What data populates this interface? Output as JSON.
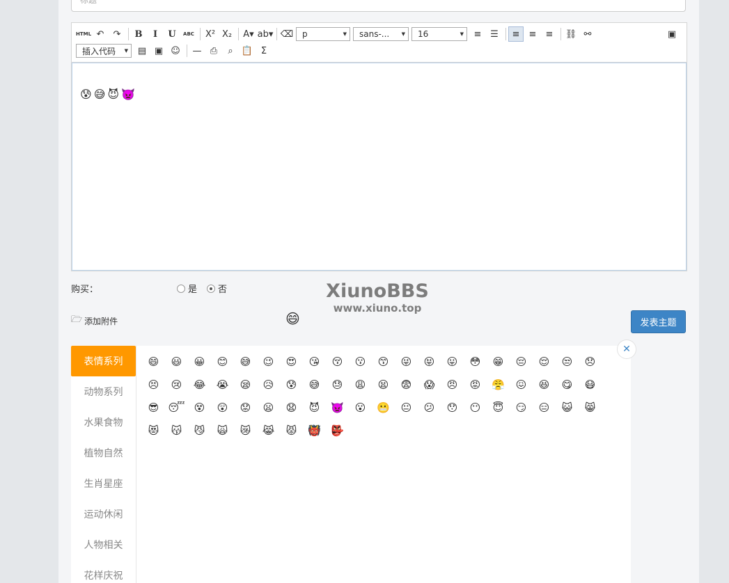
{
  "title_input": {
    "placeholder": "标题"
  },
  "toolbar": {
    "row1": [
      {
        "name": "html-source-button",
        "label": "HTML",
        "cls": "small"
      },
      {
        "name": "undo-button",
        "label": "↶"
      },
      {
        "name": "redo-button",
        "label": "↷"
      },
      {
        "sep": true
      },
      {
        "name": "bold-button",
        "label": "B",
        "cls": "ser"
      },
      {
        "name": "italic-button",
        "label": "I",
        "cls": "ser"
      },
      {
        "name": "underline-button",
        "label": "U",
        "cls": "ser"
      },
      {
        "name": "strikethrough-button",
        "label": "ABC",
        "cls": "small"
      },
      {
        "sep": true
      },
      {
        "name": "superscript-button",
        "label": "X²"
      },
      {
        "name": "subscript-button",
        "label": "X₂"
      },
      {
        "sep": true
      },
      {
        "name": "font-color-button",
        "label": "A▾"
      },
      {
        "name": "highlight-button",
        "label": "ab▾"
      },
      {
        "sep": true
      },
      {
        "name": "eraser-icon",
        "label": "⌫"
      }
    ],
    "selects": [
      {
        "name": "paragraph-select",
        "value": "p",
        "width": 78
      },
      {
        "name": "font-family-select",
        "value": "sans-...",
        "width": 80
      },
      {
        "name": "font-size-select",
        "value": "16",
        "width": 80
      }
    ],
    "row1b": [
      {
        "name": "ordered-list-button",
        "label": "≡"
      },
      {
        "name": "unordered-list-button",
        "label": "☰"
      },
      {
        "sep": true
      },
      {
        "name": "align-left-button",
        "label": "≡",
        "active": true
      },
      {
        "name": "align-center-button",
        "label": "≡"
      },
      {
        "name": "align-right-button",
        "label": "≡"
      },
      {
        "sep": true
      },
      {
        "name": "link-button",
        "label": "⛓"
      },
      {
        "name": "unlink-button",
        "label": "⚯"
      }
    ],
    "fullscreen_label": "▣",
    "code_select": "插入代码",
    "row2": [
      {
        "name": "video-icon",
        "label": "▤"
      },
      {
        "name": "image-icon",
        "label": "▣"
      },
      {
        "name": "emotion-icon",
        "label": "☺"
      },
      {
        "sep": true
      },
      {
        "name": "horizontal-rule-button",
        "label": "—"
      },
      {
        "name": "print-icon",
        "label": "⎙"
      },
      {
        "name": "preview-icon",
        "label": "⌕"
      },
      {
        "name": "paste-icon",
        "label": "📋"
      },
      {
        "name": "formula-icon",
        "label": "Σ"
      }
    ]
  },
  "editor_content": {
    "emojis": [
      "😰",
      "😅",
      "😈",
      "👿"
    ]
  },
  "buy": {
    "label": "购买：",
    "yes": "是",
    "no": "否",
    "selected": "否"
  },
  "watermark": {
    "line1": "XiunoBBS",
    "line2": "www.xiuno.top"
  },
  "attach_label": "添加附件",
  "floating_emoji": "😄",
  "submit_label": "发表主题",
  "close_label": "✕",
  "emoji_panel": {
    "categories": [
      "表情系列",
      "动物系列",
      "水果食物",
      "植物自然",
      "生肖星座",
      "运动休闲",
      "人物相关",
      "花样庆祝"
    ],
    "active_category": "表情系列",
    "emojis": [
      "😄",
      "😃",
      "😀",
      "😊",
      "😅",
      "😉",
      "😍",
      "😘",
      "😚",
      "😗",
      "😙",
      "😜",
      "😝",
      "😛",
      "😳",
      "😁",
      "😔",
      "😌",
      "😒",
      "😞",
      "😣",
      "😢",
      "😂",
      "😭",
      "😪",
      "😥",
      "😰",
      "😅",
      "😓",
      "😩",
      "😫",
      "😨",
      "😱",
      "😠",
      "😡",
      "😤",
      "😖",
      "😆",
      "😋",
      "😷",
      "😎",
      "😴",
      "😵",
      "😲",
      "😟",
      "😦",
      "😧",
      "😈",
      "👿",
      "😮",
      "😬",
      "😐",
      "😕",
      "😯",
      "😶",
      "😇",
      "😏",
      "😑",
      "😺",
      "😸",
      "😻",
      "😽",
      "😼",
      "🙀",
      "😿",
      "😹",
      "😾",
      "👹",
      "👺"
    ]
  }
}
